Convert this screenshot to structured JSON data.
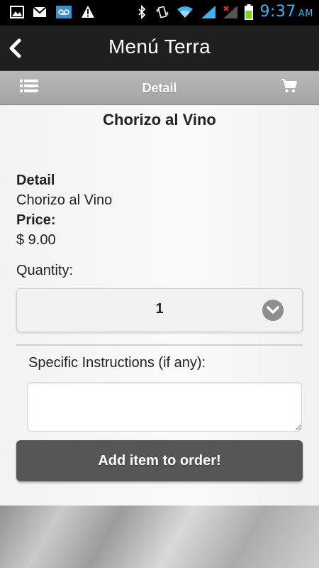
{
  "status_bar": {
    "time": "9:37",
    "ampm": "AM",
    "icons_left": [
      "image-icon",
      "gmail-icon",
      "voicemail-icon",
      "warning-icon"
    ],
    "icons_right": [
      "bluetooth-icon",
      "vibrate-icon",
      "wifi-icon",
      "signal-icon",
      "signal-off-icon",
      "battery-icon"
    ],
    "time_color": "#3fb2f0"
  },
  "header": {
    "title": "Menú Terra"
  },
  "subbar": {
    "title": "Detail"
  },
  "item": {
    "title": "Chorizo al Vino",
    "detail_label": "Detail",
    "detail_value": "Chorizo al Vino",
    "price_label": "Price:",
    "price_value": "$ 9.00"
  },
  "quantity": {
    "label": "Quantity:",
    "selected": "1"
  },
  "instructions": {
    "label": "Specific Instructions (if any):",
    "value": ""
  },
  "actions": {
    "add_label": "Add item to order!"
  }
}
